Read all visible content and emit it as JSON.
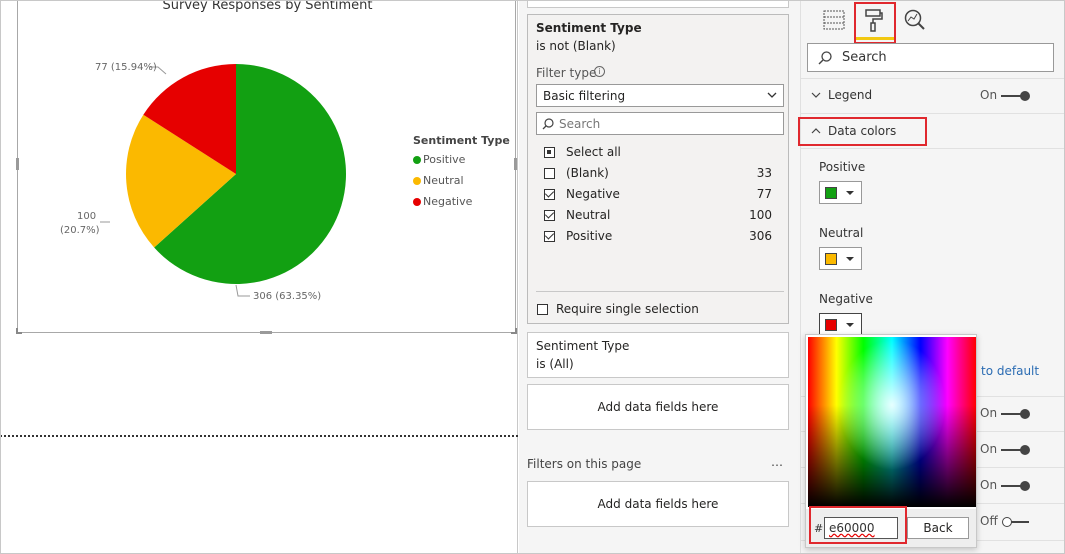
{
  "chart": {
    "title": "Survey Responses by Sentiment",
    "legend_title": "Sentiment Type",
    "labels": {
      "positive": "306 (63.35%)",
      "neutral_line1": "100",
      "neutral_line2": "(20.7%)",
      "negative": "77 (15.94%)"
    }
  },
  "chart_data": {
    "type": "pie",
    "title": "Survey Responses by Sentiment",
    "legend": "right",
    "categories": [
      "Positive",
      "Neutral",
      "Negative"
    ],
    "values": [
      306,
      100,
      77
    ],
    "percents": [
      63.35,
      20.7,
      15.94
    ],
    "colors": [
      "#12a012",
      "#fbb900",
      "#e60000"
    ]
  },
  "filter_card": {
    "title": "Sentiment Type",
    "subtitle": "is not (Blank)",
    "filter_type_label": "Filter type",
    "filter_type_value": "Basic filtering",
    "search_placeholder": "Search",
    "items": [
      {
        "label": "Select all",
        "count": "",
        "state": "partial"
      },
      {
        "label": "(Blank)",
        "count": "33",
        "state": "unchecked"
      },
      {
        "label": "Negative",
        "count": "77",
        "state": "checked"
      },
      {
        "label": "Neutral",
        "count": "100",
        "state": "checked"
      },
      {
        "label": "Positive",
        "count": "306",
        "state": "checked"
      }
    ],
    "require_single": "Require single selection"
  },
  "filter_card2": {
    "title": "Sentiment Type",
    "subtitle": "is (All)"
  },
  "add_fields_1": "Add data fields here",
  "page_filters_label": "Filters on this page",
  "page_filters_more": "…",
  "add_fields_2": "Add data fields here",
  "format": {
    "search_placeholder": "Search",
    "legend_label": "Legend",
    "legend_toggle": "On",
    "data_colors_label": "Data colors",
    "colors": [
      {
        "label": "Positive",
        "color": "#12a012"
      },
      {
        "label": "Neutral",
        "color": "#fbb900"
      },
      {
        "label": "Negative",
        "color": "#e60000"
      }
    ],
    "revert_link": "to default",
    "toggles": [
      "On",
      "On",
      "On",
      "Off"
    ]
  },
  "picker": {
    "hash": "#",
    "hex_value": "e60000",
    "back_label": "Back"
  }
}
